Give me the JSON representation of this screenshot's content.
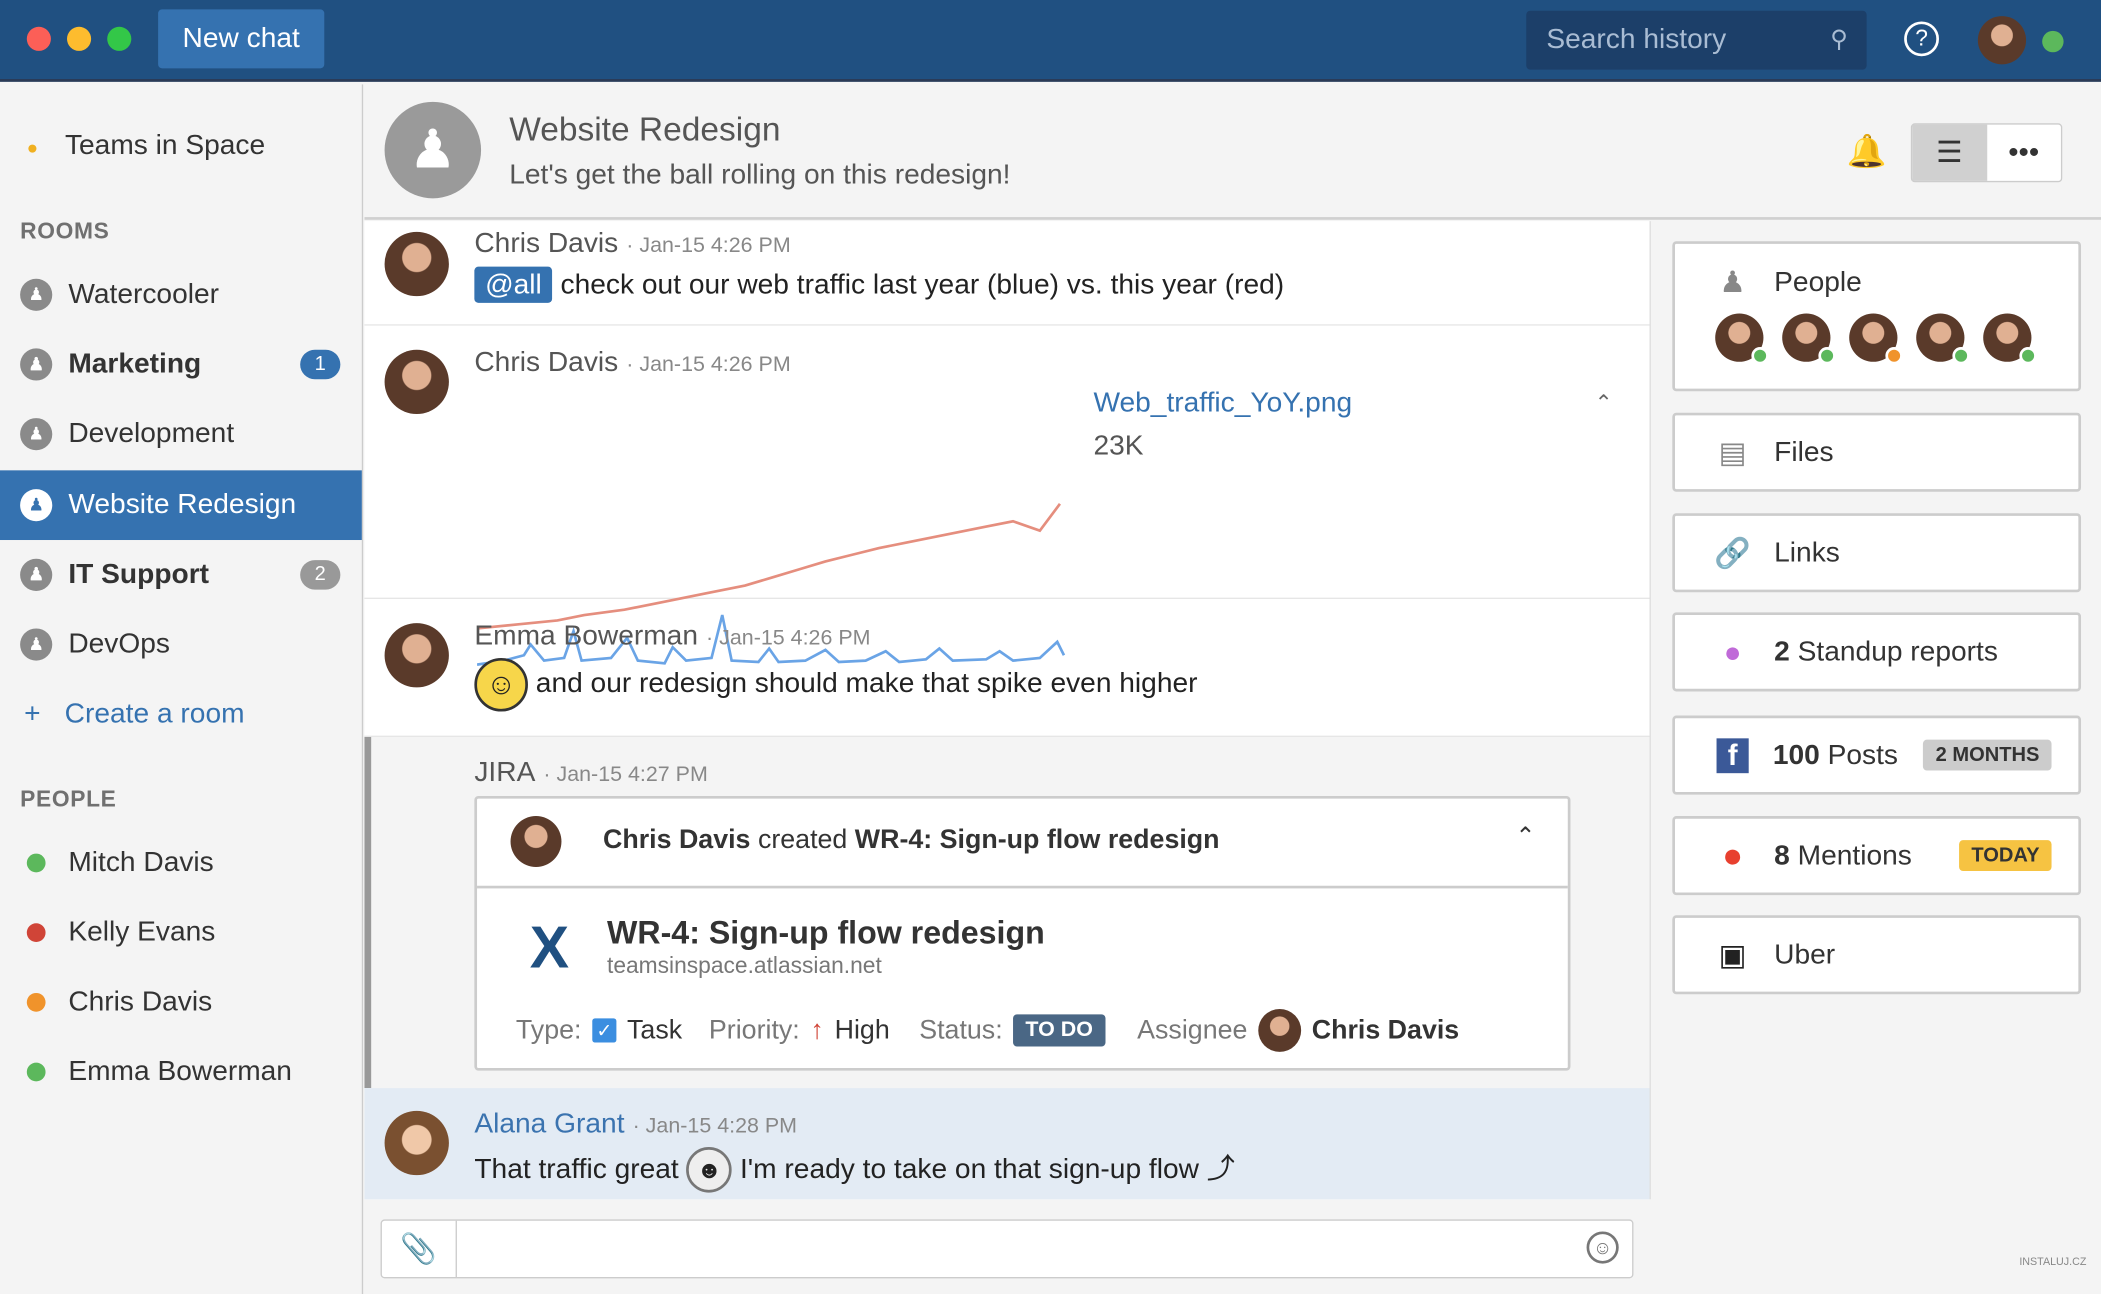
{
  "topbar": {
    "new_chat": "New chat",
    "search_placeholder": "Search history",
    "help": "?"
  },
  "sidebar": {
    "team": "Teams in Space",
    "rooms_heading": "ROOMS",
    "rooms": [
      {
        "label": "Watercooler"
      },
      {
        "label": "Marketing",
        "badge": "1",
        "badge_color": "#3572b0"
      },
      {
        "label": "Development"
      },
      {
        "label": "Website Redesign",
        "active": true
      },
      {
        "label": "IT Support",
        "badge": "2",
        "badge_color": "#999999"
      },
      {
        "label": "DevOps"
      }
    ],
    "create_room": "Create a room",
    "people_heading": "PEOPLE",
    "people": [
      {
        "name": "Mitch Davis",
        "status": "online"
      },
      {
        "name": "Kelly Evans",
        "status": "busy"
      },
      {
        "name": "Chris Davis",
        "status": "away"
      },
      {
        "name": "Emma Bowerman",
        "status": "online"
      }
    ]
  },
  "room": {
    "title": "Website Redesign",
    "topic": "Let's get the ball rolling on this redesign!"
  },
  "messages": [
    {
      "author": "Chris Davis",
      "time": "· Jan-15 4:26 PM",
      "mention": "@all",
      "text": "check out our web traffic last year (blue) vs. this year (red)"
    },
    {
      "author": "Chris Davis",
      "time": "· Jan-15 4:26 PM",
      "file_name": "Web_traffic_YoY.png",
      "file_size": "23K"
    },
    {
      "author": "Emma Bowerman",
      "time": "· Jan-15 4:26 PM",
      "text": "and our redesign should make that spike even higher"
    },
    {
      "author": "JIRA",
      "time": "· Jan-15 4:27 PM"
    },
    {
      "author": "Alana Grant",
      "time": "· Jan-15 4:28 PM",
      "text_before": "That traffic great",
      "text_after": "I'm ready to take on that sign-up flow ⤴"
    }
  ],
  "jira": {
    "creator": "Chris Davis",
    "action": "created",
    "issue": "WR-4: Sign-up flow redesign",
    "title": "WR-4: Sign-up flow redesign",
    "site": "teamsinspace.atlassian.net",
    "type_label": "Type:",
    "type": "Task",
    "priority_label": "Priority:",
    "priority": "High",
    "status_label": "Status:",
    "status": "TO DO",
    "assignee_label": "Assignee",
    "assignee": "Chris Davis"
  },
  "panel": {
    "people": "People",
    "files": "Files",
    "links": "Links",
    "standup_count": "2",
    "standup": "Standup reports",
    "posts_count": "100",
    "posts": "Posts",
    "posts_tag": "2 MONTHS",
    "mentions_count": "8",
    "mentions": "Mentions",
    "mentions_tag": "TODAY",
    "uber": "Uber"
  },
  "watermark": "INSTALUJ.CZ",
  "colors": {
    "brand": "#205081",
    "accent": "#3572b0",
    "online": "#5cb85c",
    "busy": "#d04437",
    "away": "#f0932b"
  }
}
